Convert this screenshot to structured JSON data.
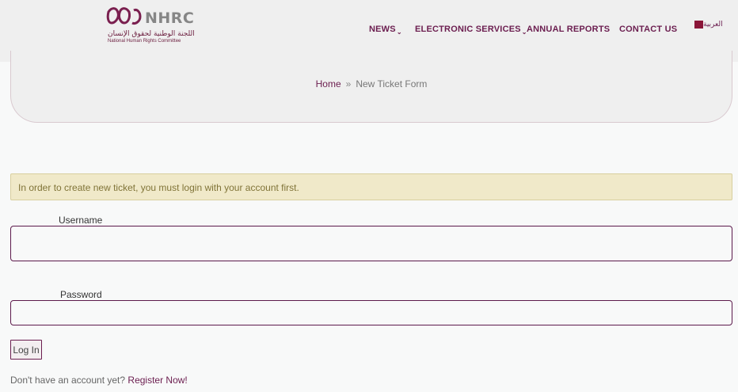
{
  "header": {
    "logo": {
      "abbr": "NHRC",
      "arabic_name": "اللجنة الوطنية لحقوق الإنسان",
      "english_name": "National Human Rights Committee"
    },
    "nav": [
      {
        "label": "NEWS",
        "has_dropdown": true
      },
      {
        "label": "ELECTRONIC SERVICES",
        "has_dropdown": true
      },
      {
        "label": "ANNUAL REPORTS",
        "has_dropdown": false
      },
      {
        "label": "CONTACT US",
        "has_dropdown": false
      }
    ],
    "dropdown_glyph": "⌄",
    "language": {
      "label": "العربية",
      "flag_color": "#8a1538"
    }
  },
  "breadcrumb": {
    "home": "Home",
    "separator": "»",
    "current": "New Ticket Form"
  },
  "notice": {
    "text": "In order to create new ticket, you must login with your account first."
  },
  "form": {
    "username_label": "Username",
    "username_value": "",
    "password_label": "Password",
    "password_value": "",
    "login_label": "Log In"
  },
  "register": {
    "prompt": "Don't have an account yet?",
    "link": "Register Now!"
  },
  "colors": {
    "brand": "#6b1d4f",
    "notice_bg": "#f0e9c9",
    "notice_text": "#807438",
    "header_bg": "#efefef"
  }
}
